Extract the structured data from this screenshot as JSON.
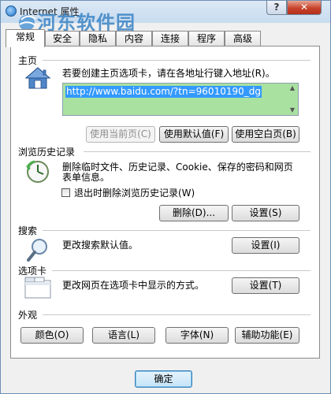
{
  "window": {
    "title": "Internet 属性",
    "help_label": "?",
    "close_label": "✕"
  },
  "watermark": {
    "name": "河东软件园",
    "url": "www.pc0359.cn"
  },
  "tabs": [
    {
      "label": "常规",
      "active": true
    },
    {
      "label": "安全",
      "active": false
    },
    {
      "label": "隐私",
      "active": false
    },
    {
      "label": "内容",
      "active": false
    },
    {
      "label": "连接",
      "active": false
    },
    {
      "label": "程序",
      "active": false
    },
    {
      "label": "高级",
      "active": false
    }
  ],
  "homepage": {
    "title": "主页",
    "description": "若要创建主页选项卡，请在各地址行键入地址(R)。",
    "url_value": "http://www.baidu.com/?tn=96010190_dg",
    "btn_use_current": "使用当前页(C)",
    "btn_use_default": "使用默认值(F)",
    "btn_use_blank": "使用空白页(B)"
  },
  "history": {
    "title": "浏览历史记录",
    "description_line1": "删除临时文件、历史记录、Cookie、保存的密码和网页",
    "description_line2": "表单信息。",
    "checkbox_label": "退出时删除浏览历史记录(W)",
    "btn_delete": "删除(D)...",
    "btn_settings": "设置(S)"
  },
  "search": {
    "title": "搜索",
    "description": "更改搜索默认值。",
    "btn_settings": "设置(I)"
  },
  "tabs_section": {
    "title": "选项卡",
    "description": "更改网页在选项卡中显示的方式。",
    "btn_settings": "设置(T)"
  },
  "appearance": {
    "title": "外观",
    "btn_colors": "颜色(O)",
    "btn_languages": "语言(L)",
    "btn_fonts": "字体(N)",
    "btn_accessibility": "辅助功能(E)"
  },
  "footer": {
    "btn_ok": "确定"
  }
}
